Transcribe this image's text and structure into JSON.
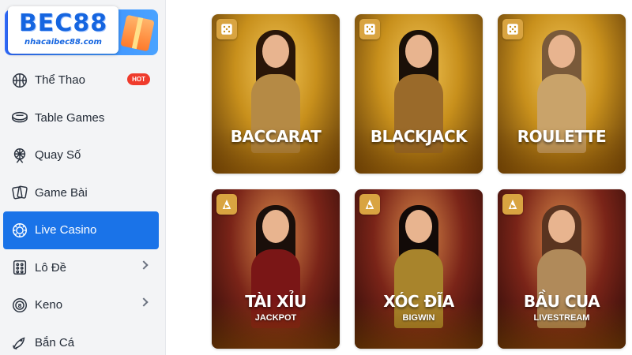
{
  "logo": {
    "brand": "BEC88",
    "domain": "nhacaibec88.com"
  },
  "sidebar": {
    "items": [
      {
        "label": "Thể Thao",
        "icon": "basketball-icon",
        "badge": "HOT",
        "active": false,
        "chevron": false
      },
      {
        "label": "Table Games",
        "icon": "card-table-icon",
        "active": false,
        "chevron": false
      },
      {
        "label": "Quay Số",
        "icon": "ferris-wheel-icon",
        "active": false,
        "chevron": false
      },
      {
        "label": "Game Bài",
        "icon": "cards-icon",
        "active": false,
        "chevron": false
      },
      {
        "label": "Live Casino",
        "icon": "casino-chip-icon",
        "active": true,
        "chevron": false
      },
      {
        "label": "Lô Đề",
        "icon": "lottery-grid-icon",
        "active": false,
        "chevron": true
      },
      {
        "label": "Keno",
        "icon": "keno-coin-icon",
        "active": false,
        "chevron": true
      },
      {
        "label": "Bắn Cá",
        "icon": "fish-icon",
        "active": false,
        "chevron": false
      }
    ]
  },
  "games": [
    {
      "title": "BACCARAT",
      "subtitle": "",
      "category_icon": "dice-icon",
      "theme": "gold"
    },
    {
      "title": "BLACKJACK",
      "subtitle": "",
      "category_icon": "dice-icon",
      "theme": "gold"
    },
    {
      "title": "ROULETTE",
      "subtitle": "",
      "category_icon": "dice-icon",
      "theme": "gold"
    },
    {
      "title": "TÀI XỈU",
      "subtitle": "JACKPOT",
      "category_icon": "play-icon",
      "theme": "red"
    },
    {
      "title": "XÓC ĐĨA",
      "subtitle": "BIGWIN",
      "category_icon": "play-icon",
      "theme": "red"
    },
    {
      "title": "BẦU CUA",
      "subtitle": "LIVESTREAM",
      "category_icon": "play-icon",
      "theme": "red"
    }
  ],
  "colors": {
    "accent": "#1a73e8",
    "hot": "#ef3b2c",
    "gold": "#c8901c",
    "sidebar_bg": "#f3f4f6"
  }
}
